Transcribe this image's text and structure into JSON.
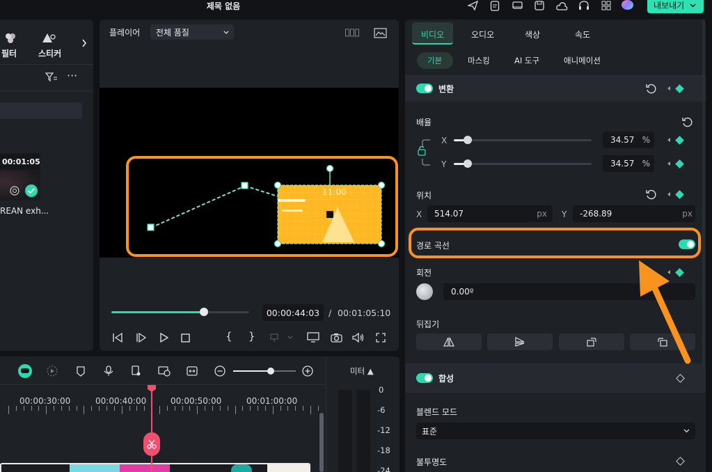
{
  "window": {
    "title": "제목 없음",
    "export_label": "내보내기"
  },
  "toolbar_icons": [
    "send-icon",
    "doc-icon",
    "monitor-icon",
    "save-icon",
    "cloud-icon",
    "headset-icon",
    "grid-icon",
    "avatar"
  ],
  "left_panel": {
    "tabs": [
      {
        "label": "필터",
        "icon": "filter-effect-icon"
      },
      {
        "label": "스티커",
        "icon": "sticker-icon"
      }
    ],
    "media_item": {
      "duration": "00:01:05",
      "name": "REAN exh..."
    }
  },
  "player": {
    "label": "플레이어",
    "quality": "전체 품질",
    "overlay_time": "11:00",
    "current_time": "00:00:44:03",
    "separator": "/",
    "total_time": "00:01:05:10",
    "progress": 0.67
  },
  "timeline": {
    "meter_label": "미터 ▲",
    "time_marks": [
      "00:00:30:00",
      "00:00:40:00",
      "00:00:50:00",
      "00:01:00:00"
    ],
    "meter_scale": [
      "0",
      "-6",
      "-12",
      "-18",
      "-24"
    ],
    "zoom_level": 0.6
  },
  "inspector": {
    "tabs": [
      "비디오",
      "오디오",
      "색상",
      "속도"
    ],
    "active_tab": "비디오",
    "subtabs": [
      "기본",
      "마스킹",
      "AI 도구",
      "애니메이션"
    ],
    "active_subtab": "기본",
    "transform": {
      "label": "변환",
      "scale_label": "배율",
      "x_label": "X",
      "y_label": "Y",
      "scale_x": "34.57",
      "scale_y": "34.57",
      "unit": "%",
      "scale_x_fraction": 0.1,
      "scale_y_fraction": 0.1,
      "position_label": "위치",
      "pos_x": "514.07",
      "pos_y": "-268.89",
      "pos_unit": "px",
      "path_curve_label": "경로 곡선",
      "rotate_label": "회전",
      "rotate_value": "0.00º",
      "flip_label": "뒤집기"
    },
    "composite": {
      "label": "합성",
      "blend_mode_label": "블렌드 모드",
      "blend_mode_value": "표준",
      "opacity_label": "불투명도"
    }
  },
  "colors": {
    "accent": "#2fd9b0",
    "highlight": "#f7931e",
    "playhead": "#f0506e"
  }
}
